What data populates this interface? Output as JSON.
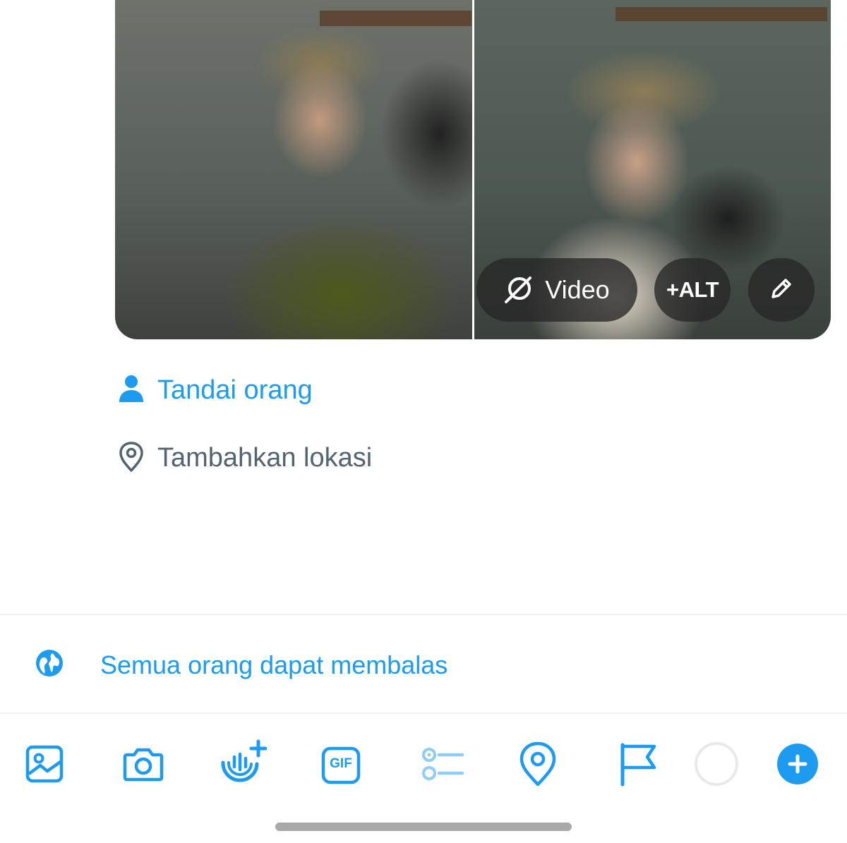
{
  "media": {
    "video_button": {
      "label": "Video",
      "icon": "video-off-icon"
    },
    "alt_button": {
      "label": "+ALT"
    },
    "edit_button": {
      "icon": "pencil-icon"
    }
  },
  "options": {
    "tag_people": {
      "label": "Tandai orang",
      "icon": "person-icon"
    },
    "add_location": {
      "label": "Tambahkan lokasi",
      "icon": "location-pin-icon"
    }
  },
  "reply_settings": {
    "label": "Semua orang dapat membalas",
    "icon": "globe-icon"
  },
  "toolbar": {
    "items": [
      {
        "name": "image",
        "icon": "image-icon"
      },
      {
        "name": "camera",
        "icon": "camera-icon"
      },
      {
        "name": "audio-space",
        "icon": "spaces-add-icon"
      },
      {
        "name": "gif",
        "icon": "gif-icon",
        "label": "GIF"
      },
      {
        "name": "poll",
        "icon": "poll-icon"
      },
      {
        "name": "location",
        "icon": "location-pin-icon"
      },
      {
        "name": "flag",
        "icon": "flag-icon"
      },
      {
        "name": "char-counter",
        "icon": "progress-ring-icon"
      },
      {
        "name": "add-thread",
        "icon": "plus-circle-icon"
      }
    ]
  },
  "colors": {
    "accent": "#1d9bf0",
    "secondary_text": "#536471",
    "disabled_accent": "#8ecdf7",
    "divider": "#eff1f5"
  }
}
